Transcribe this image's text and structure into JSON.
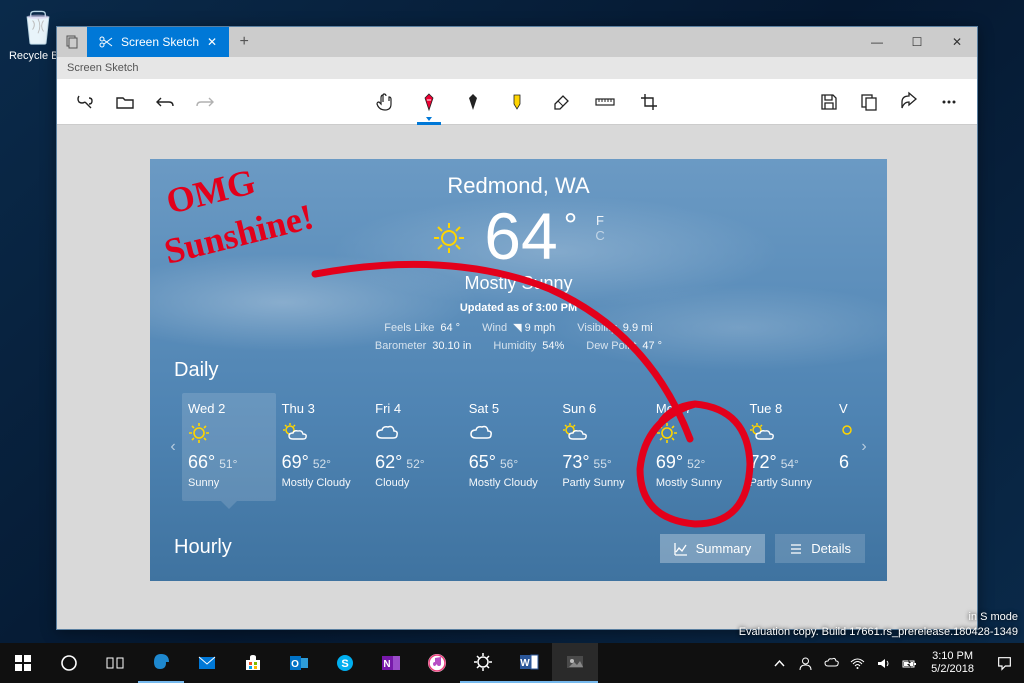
{
  "desktop": {
    "recycle_bin": "Recycle Bin"
  },
  "window": {
    "tab_title": "Screen Sketch",
    "subtitle": "Screen Sketch",
    "win_min": "—",
    "win_max": "▢",
    "win_close": "✕"
  },
  "weather": {
    "city": "Redmond, WA",
    "temp": "64",
    "deg": "°",
    "unit_f": "F",
    "unit_c": "C",
    "condition": "Mostly Sunny",
    "updated": "Updated as of 3:00 PM",
    "stats_row1": [
      {
        "label": "Feels Like",
        "value": "64 °"
      },
      {
        "label": "Wind",
        "value": "◥ 9 mph"
      },
      {
        "label": "Visibility",
        "value": "9.9 mi"
      }
    ],
    "stats_row2": [
      {
        "label": "Barometer",
        "value": "30.10 in"
      },
      {
        "label": "Humidity",
        "value": "54%"
      },
      {
        "label": "Dew Point",
        "value": "47 °"
      }
    ],
    "daily_label": "Daily",
    "hourly_label": "Hourly",
    "btn_summary": "Summary",
    "btn_details": "Details",
    "days": [
      {
        "name": "Wed 2",
        "icon": "sun",
        "hi": "66°",
        "lo": "51°",
        "cond": "Sunny",
        "sel": true
      },
      {
        "name": "Thu 3",
        "icon": "partly",
        "hi": "69°",
        "lo": "52°",
        "cond": "Mostly Cloudy"
      },
      {
        "name": "Fri 4",
        "icon": "cloud",
        "hi": "62°",
        "lo": "52°",
        "cond": "Cloudy"
      },
      {
        "name": "Sat 5",
        "icon": "cloud",
        "hi": "65°",
        "lo": "56°",
        "cond": "Mostly Cloudy"
      },
      {
        "name": "Sun 6",
        "icon": "partly",
        "hi": "73°",
        "lo": "55°",
        "cond": "Partly Sunny"
      },
      {
        "name": "Mon 7",
        "icon": "sun",
        "hi": "69°",
        "lo": "52°",
        "cond": "Mostly Sunny"
      },
      {
        "name": "Tue 8",
        "icon": "partly",
        "hi": "72°",
        "lo": "54°",
        "cond": "Partly Sunny"
      }
    ],
    "day_partial": {
      "name": "V",
      "hi": "6"
    }
  },
  "annotation": {
    "text1": "OMG",
    "text2": "Sunshine!"
  },
  "watermark": {
    "l1": "in S mode",
    "l2": "Evaluation copy. Build 17661.rs_prerelease.180428-1349"
  },
  "taskbar": {
    "time": "3:10 PM",
    "date": "5/2/2018"
  }
}
